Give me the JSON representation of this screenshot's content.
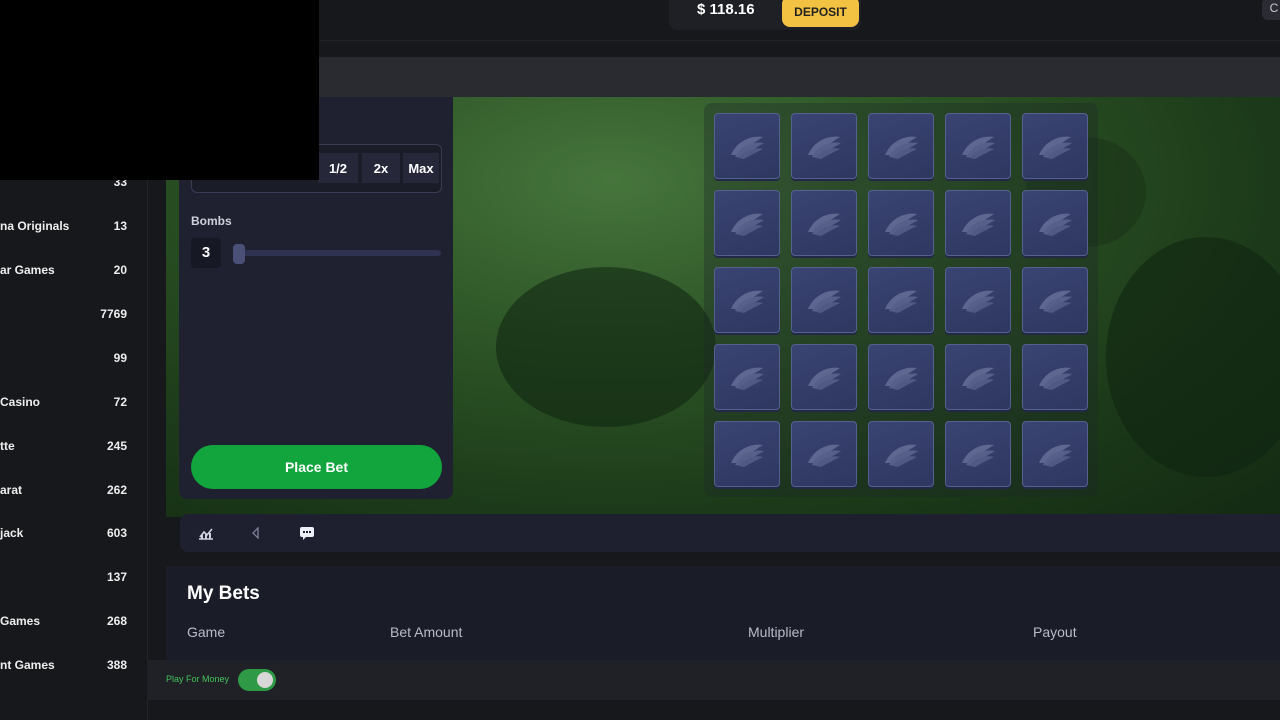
{
  "header": {
    "balance": "$ 118.16",
    "deposit_label": "DEPOSIT",
    "corner_label": "C"
  },
  "sidebar": {
    "items": [
      {
        "label": "",
        "count": "33"
      },
      {
        "label": "na Originals",
        "count": "13"
      },
      {
        "label": "ar Games",
        "count": "20"
      },
      {
        "label": "",
        "count": "7769"
      },
      {
        "label": "",
        "count": "99"
      },
      {
        "label": "Casino",
        "count": "72"
      },
      {
        "label": "tte",
        "count": "245"
      },
      {
        "label": "arat",
        "count": "262"
      },
      {
        "label": "jack",
        "count": "603"
      },
      {
        "label": "",
        "count": "137"
      },
      {
        "label": "Games",
        "count": "268"
      },
      {
        "label": "nt Games",
        "count": "388"
      }
    ]
  },
  "bet_panel": {
    "half_label": "1/2",
    "double_label": "2x",
    "max_label": "Max",
    "bombs_label": "Bombs",
    "bombs_value": "3",
    "bombs_slider_fraction": 0.0,
    "place_bet_label": "Place Bet"
  },
  "board": {
    "rows": 5,
    "cols": 5,
    "tile_icon": "banana-icon"
  },
  "toolbar": {
    "icons": [
      "stats-icon",
      "sound-icon",
      "chat-icon"
    ]
  },
  "my_bets": {
    "title": "My Bets",
    "columns": [
      "Game",
      "Bet Amount",
      "Multiplier",
      "Payout"
    ]
  },
  "footer": {
    "play_for_money_label": "Play For Money",
    "play_for_money_on": true
  },
  "colors": {
    "accent_green": "#12a43d",
    "deposit_yellow": "#f3c242",
    "tile_blue": "#34406b"
  }
}
